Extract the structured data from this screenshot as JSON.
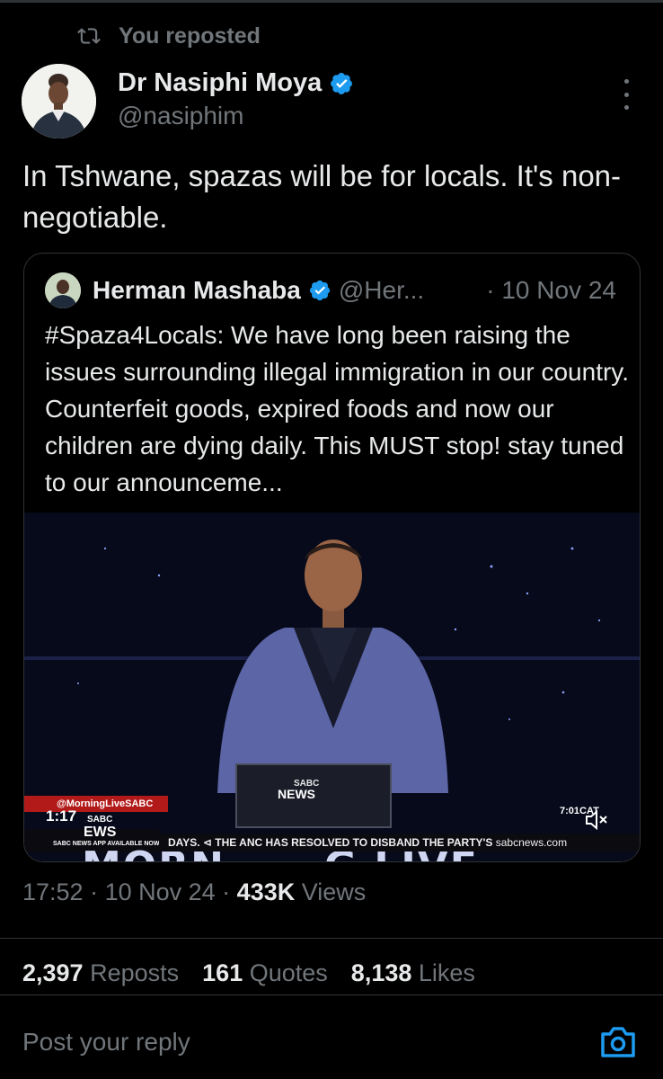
{
  "repost": {
    "label": "You reposted"
  },
  "author": {
    "name": "Dr Nasiphi Moya",
    "handle": "@nasiphim"
  },
  "tweet": {
    "text": "In Tshwane, spazas will be for locals. It's non-negotiable."
  },
  "quote": {
    "name": "Herman Mashaba",
    "handle": "@Her...",
    "date": "· 10 Nov 24",
    "text": "#Spaza4Locals: We have long been raising the issues surrounding illegal immigration in our country. Counterfeit goods, expired foods and now our children are dying daily. This MUST stop! stay tuned to our announceme...",
    "video": {
      "duration": "1:17",
      "clock": "7:01CAT",
      "show_left": "MORN",
      "show_right": "G LIVE",
      "banner_handle": "@MorningLiveSABC",
      "logo_top": "SABC",
      "logo_bottom": "EWS",
      "app_line": "SABC NEWS APP AVAILABLE NOW",
      "desk_logo_top": "SABC",
      "desk_logo_bottom": "NEWS",
      "ticker": "DAYS.  ⊲  THE ANC HAS RESOLVED TO DISBAND THE PARTY'S ",
      "ticker_site": "sabcnews.com"
    }
  },
  "meta": {
    "time": "17:52",
    "date": "10 Nov 24",
    "views_count": "433K",
    "views_label": "Views"
  },
  "stats": {
    "reposts_count": "2,397",
    "reposts_label": "Reposts",
    "quotes_count": "161",
    "quotes_label": "Quotes",
    "likes_count": "8,138",
    "likes_label": "Likes"
  },
  "reply": {
    "placeholder": "Post your reply"
  },
  "colors": {
    "background": "#000000",
    "text": "#e7e9ea",
    "muted": "#71767b",
    "border": "#2f3336",
    "verified": "#1d9bf0",
    "accent": "#1d9bf0"
  },
  "icons": {
    "repost": "repost-icon",
    "verified": "verified-badge-icon",
    "more": "more-icon",
    "mute": "mute-icon",
    "camera": "camera-icon"
  }
}
